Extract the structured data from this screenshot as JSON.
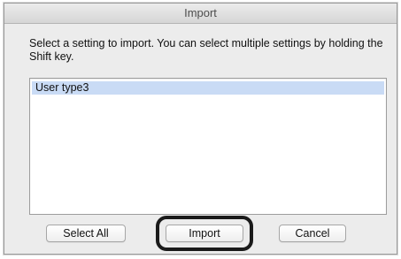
{
  "dialog": {
    "title": "Import",
    "message": "Select a setting to import. You can select multiple settings by holding the Shift key."
  },
  "settings_list": {
    "items": [
      {
        "label": "User type3",
        "selected": true
      }
    ]
  },
  "buttons": {
    "select_all": "Select All",
    "import": "Import",
    "cancel": "Cancel"
  },
  "colors": {
    "selection": "#c9dbf5",
    "highlight_ring": "#1a1a1a"
  }
}
